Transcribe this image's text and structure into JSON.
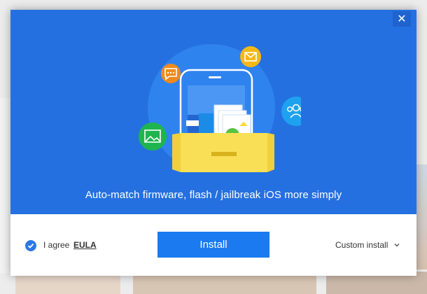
{
  "window": {
    "close_glyph": "✕",
    "tagline": "Auto-match firmware, flash / jailbreak iOS more simply"
  },
  "footer": {
    "agree_checked": true,
    "agree_text": "I agree",
    "eula_link": "EULA",
    "install_label": "Install",
    "custom_install_label": "Custom install"
  },
  "icons": {
    "chat": "chat-bubble-icon",
    "mail": "envelope-icon",
    "users": "users-group-icon",
    "image": "picture-icon"
  },
  "colors": {
    "hero_bg": "#2570e0",
    "install_button": "#1b7af0",
    "checkbox": "#2d78e4",
    "chat_badge": "#ef8a1e",
    "mail_badge": "#f5b816",
    "users_badge": "#1ea2f0",
    "image_badge": "#1fb54e",
    "drawer": "#f9df55"
  }
}
